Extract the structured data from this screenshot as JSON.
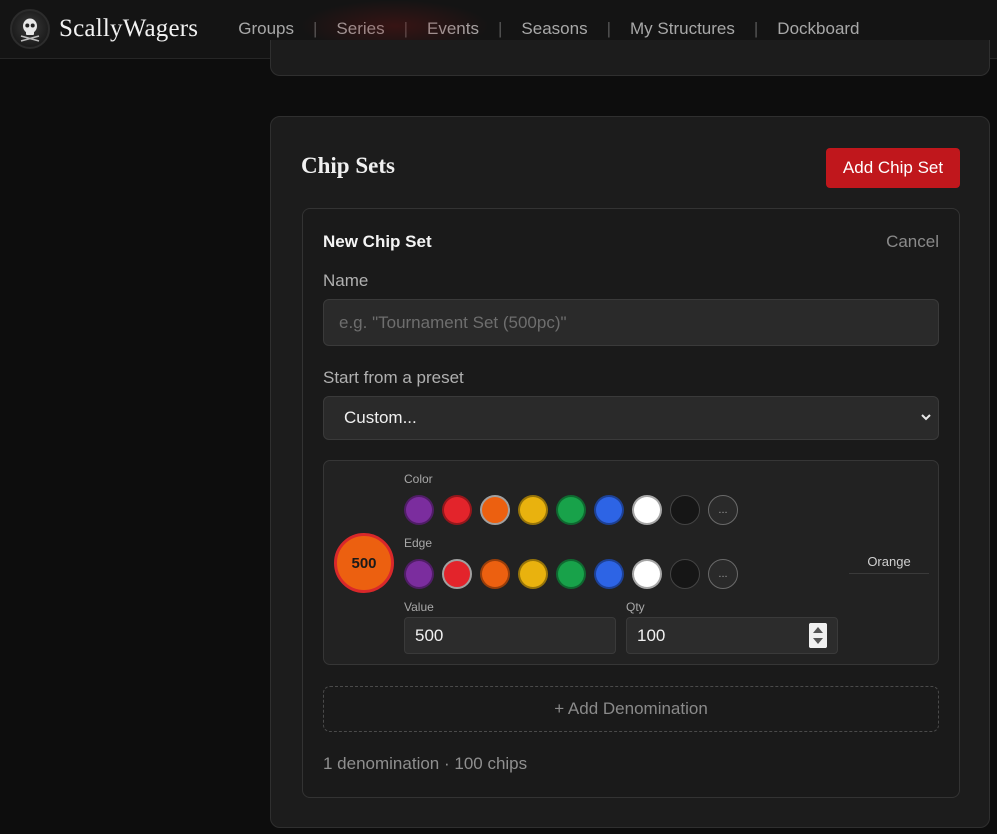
{
  "header": {
    "brand": "ScallyWagers",
    "logo_icon": "skull-logo-icon",
    "nav": [
      {
        "label": "Groups"
      },
      {
        "label": "Series"
      },
      {
        "label": "Events"
      },
      {
        "label": "Seasons"
      },
      {
        "label": "My Structures"
      },
      {
        "label": "Dockboard"
      }
    ],
    "separator": "|"
  },
  "chip_sets": {
    "title": "Chip Sets",
    "add_button": "Add Chip Set",
    "accent_color": "#c0171c"
  },
  "new_set": {
    "title": "New Chip Set",
    "cancel": "Cancel",
    "name_label": "Name",
    "name_value": "",
    "name_placeholder": "e.g. \"Tournament Set (500pc)\"",
    "preset_label": "Start from a preset",
    "preset_selected": "Custom..."
  },
  "denomination": {
    "chip_value_display": "500",
    "color_label": "Color",
    "edge_label": "Edge",
    "color_name": "Orange",
    "value_label": "Value",
    "value": "500",
    "qty_label": "Qty",
    "qty": "100",
    "more_label": "...",
    "swatches": [
      {
        "name": "purple",
        "hex": "#7b2d9e"
      },
      {
        "name": "red",
        "hex": "#e3242b"
      },
      {
        "name": "orange",
        "hex": "#ec6010"
      },
      {
        "name": "yellow",
        "hex": "#e9b20e"
      },
      {
        "name": "green",
        "hex": "#18a24a"
      },
      {
        "name": "blue",
        "hex": "#2d64e5"
      },
      {
        "name": "white",
        "hex": "#ffffff"
      },
      {
        "name": "black",
        "hex": "#161616"
      }
    ],
    "selected_color": "orange",
    "selected_edge": "red"
  },
  "add_denomination": "+ Add Denomination",
  "summary": "1 denomination · 100 chips"
}
